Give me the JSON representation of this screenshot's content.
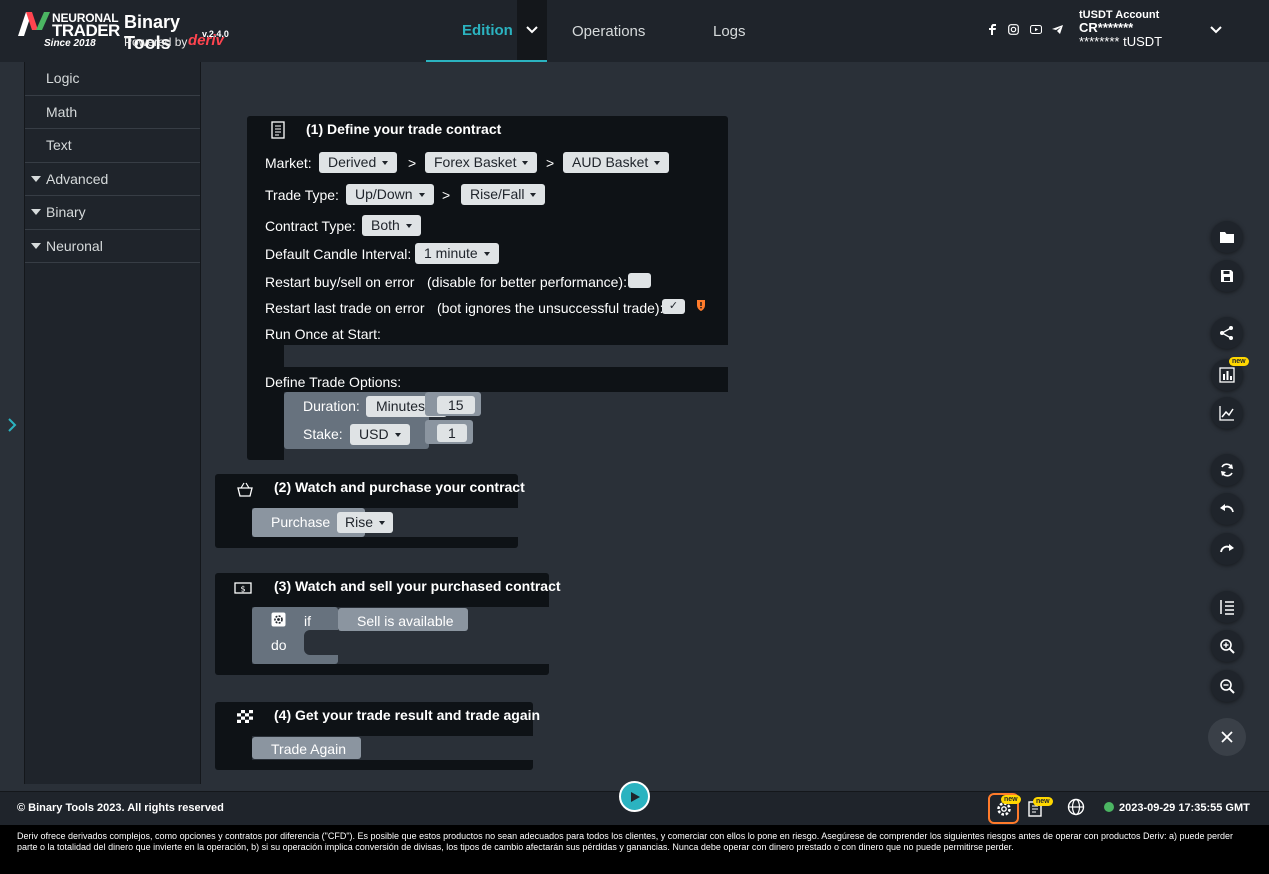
{
  "brand": {
    "name_line1": "NEURONAL",
    "name_line2": "TRADER",
    "since": "Since 2018",
    "product": "Binary Tools",
    "version": "v.2.4.0",
    "powered_by": "Powered by",
    "powered_brand": "deriv"
  },
  "nav": {
    "edition": "Edition",
    "operations": "Operations",
    "logs": "Logs"
  },
  "account": {
    "label": "tUSDT Account",
    "id": "CR*******",
    "balance": "******** tUSDT"
  },
  "toolbox": {
    "items": [
      {
        "label": "Logic",
        "caret": false
      },
      {
        "label": "Math",
        "caret": false
      },
      {
        "label": "Text",
        "caret": false
      },
      {
        "label": "Advanced",
        "caret": true
      },
      {
        "label": "Binary",
        "caret": true
      },
      {
        "label": "Neuronal",
        "caret": true
      }
    ]
  },
  "block1": {
    "title": "(1) Define your trade contract",
    "market_label": "Market:",
    "market": [
      "Derived",
      "Forex Basket",
      "AUD Basket"
    ],
    "sep": ">",
    "trade_type_label": "Trade Type:",
    "trade_type": [
      "Up/Down",
      "Rise/Fall"
    ],
    "contract_type_label": "Contract Type:",
    "contract_type": "Both",
    "candle_label": "Default Candle Interval:",
    "candle": "1 minute",
    "restart_err_label": "Restart buy/sell on error",
    "restart_err_hint": "(disable for better performance):",
    "restart_last_label": "Restart last trade on error",
    "restart_last_hint": "(bot ignores the unsuccessful trade):",
    "restart_last_check": "✓",
    "run_once_label": "Run Once at Start:",
    "options_label": "Define Trade Options:",
    "duration_label": "Duration:",
    "duration_unit": "Minutes",
    "duration_value": "15",
    "stake_label": "Stake:",
    "stake_currency": "USD",
    "stake_value": "1"
  },
  "block2": {
    "title": "(2) Watch and purchase your contract",
    "purchase_label": "Purchase",
    "purchase_value": "Rise"
  },
  "block3": {
    "title": "(3) Watch and sell your purchased contract",
    "if_label": "if",
    "do_label": "do",
    "condition": "Sell is available"
  },
  "block4": {
    "title": "(4) Get your trade result and trade again",
    "action": "Trade Again"
  },
  "badges": {
    "new": "new"
  },
  "footer": {
    "copyright": "© Binary Tools 2023. All rights reserved",
    "datetime": "2023-09-29 17:35:55 GMT",
    "disclaimer": "Deriv ofrece derivados complejos, como opciones y contratos por diferencia (\"CFD\"). Es posible que estos productos no sean adecuados para todos los clientes, y comerciar con ellos lo pone en riesgo. Asegúrese de comprender los siguientes riesgos antes de operar con productos Deriv: a) puede perder parte o la totalidad del dinero que invierte en la operación, b) si su operación implica conversión de divisas, los tipos de cambio afectarán sus pérdidas y ganancias. Nunca debe operar con dinero prestado o con dinero que no puede permitirse perder."
  },
  "colors": {
    "accent": "#2bb3c0",
    "header_bg": "#1f242b",
    "workspace_bg": "#2a3038",
    "block_bg": "#0e1216",
    "status_green": "#4bb562",
    "brand_red": "#ff444f"
  }
}
